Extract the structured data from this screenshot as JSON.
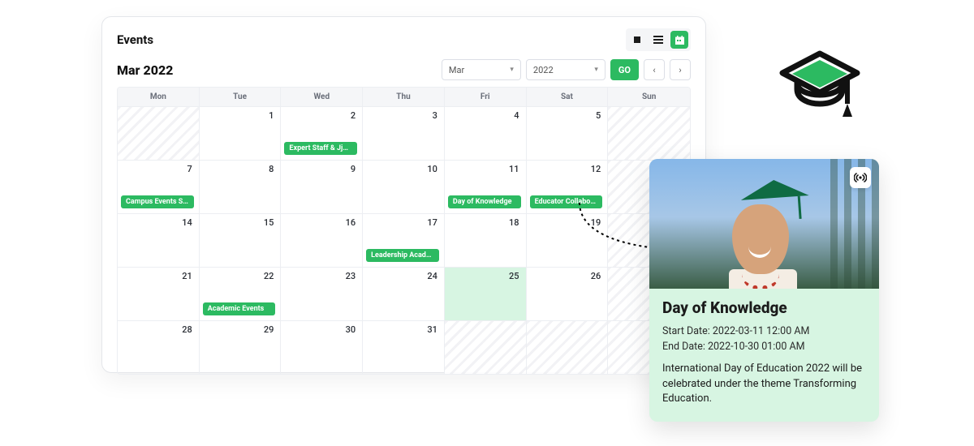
{
  "colors": {
    "accent": "#2cba61",
    "highlight": "#d7f5e2"
  },
  "header": {
    "title": "Events"
  },
  "view_toggle": {
    "options": [
      "stop-icon",
      "list-icon",
      "calendar-icon"
    ],
    "active_index": 2
  },
  "controls": {
    "current_label": "Mar 2022",
    "month_select": {
      "value": "Mar"
    },
    "year_select": {
      "value": "2022"
    },
    "go_label": "GO",
    "prev_icon": "‹",
    "next_icon": "›"
  },
  "days": [
    "Mon",
    "Tue",
    "Wed",
    "Thu",
    "Fri",
    "Sat",
    "Sun"
  ],
  "weeks": [
    [
      {
        "date": "",
        "out": true
      },
      {
        "date": "1"
      },
      {
        "date": "2",
        "event": "Expert Staff & Jjou..."
      },
      {
        "date": "3"
      },
      {
        "date": "4"
      },
      {
        "date": "5"
      },
      {
        "date": "",
        "out": true
      }
    ],
    [
      {
        "date": "7",
        "event": "Campus Events Sc.."
      },
      {
        "date": "8"
      },
      {
        "date": "9"
      },
      {
        "date": "10"
      },
      {
        "date": "11",
        "event": "Day of Knowledge"
      },
      {
        "date": "12",
        "event": "Educator Collaborative"
      },
      {
        "date": "",
        "out": true
      }
    ],
    [
      {
        "date": "14"
      },
      {
        "date": "15"
      },
      {
        "date": "16"
      },
      {
        "date": "17",
        "event": "Leadership Academy"
      },
      {
        "date": "18"
      },
      {
        "date": "19"
      },
      {
        "date": "",
        "out": true
      }
    ],
    [
      {
        "date": "21"
      },
      {
        "date": "22",
        "event": "Academic Events"
      },
      {
        "date": "23"
      },
      {
        "date": "24"
      },
      {
        "date": "25",
        "highlight": true
      },
      {
        "date": "26"
      },
      {
        "date": "",
        "out": true
      }
    ],
    [
      {
        "date": "28"
      },
      {
        "date": "29"
      },
      {
        "date": "30"
      },
      {
        "date": "31"
      },
      {
        "date": "",
        "out": true
      },
      {
        "date": "",
        "out": true
      },
      {
        "date": "",
        "out": true
      }
    ]
  ],
  "detail": {
    "title": "Day of Knowledge",
    "start_label": "Start Date: 2022-03-11 12:00 AM",
    "end_label": "End Date: 2022-10-30 01:00 AM",
    "description": "International Day of Education 2022 will be celebrated under the theme Transforming Education.",
    "badge_icon": "broadcast-icon",
    "image_alt": "graduate-photo"
  },
  "decor": {
    "cap_icon": "graduation-cap-icon"
  }
}
